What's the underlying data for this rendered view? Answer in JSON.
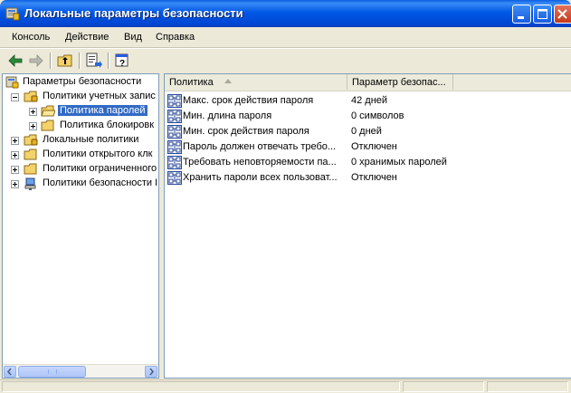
{
  "window": {
    "title": "Локальные параметры безопасности",
    "controls": [
      "minimize-icon",
      "maximize-icon",
      "close-icon"
    ]
  },
  "menu": {
    "items": [
      "Консоль",
      "Действие",
      "Вид",
      "Справка"
    ]
  },
  "toolbar": {
    "buttons": [
      "back-icon",
      "forward-icon",
      "up-level-icon",
      "export-list-icon",
      "help-icon"
    ]
  },
  "tree": {
    "root": "Параметры безопасности",
    "items": [
      {
        "label": "Политики учетных записей",
        "shown": "Политики учетных запис"
      },
      {
        "label": "Политика паролей",
        "selected": true
      },
      {
        "label": "Политика блокировки",
        "shown": "Политика блокировк"
      },
      {
        "label": "Локальные политики"
      },
      {
        "label": "Политики открытого клю",
        "shown": "Политики открытого клк"
      },
      {
        "label": "Политики ограниченного",
        "shown": "Политики ограниченного"
      },
      {
        "label": "Политики безопасности IP",
        "shown": "Политики безопасности I"
      }
    ]
  },
  "list": {
    "columns": [
      "Политика",
      "Параметр безопас..."
    ],
    "rows": [
      {
        "policy": "Макс. срок действия пароля",
        "value": "42 дней"
      },
      {
        "policy": "Мин. длина пароля",
        "value": "0 символов"
      },
      {
        "policy": "Мин. срок действия пароля",
        "value": "0 дней"
      },
      {
        "policy": "Пароль должен отвечать требо...",
        "value": "Отключен"
      },
      {
        "policy": "Требовать неповторяемости па...",
        "value": "0 хранимых паролей"
      },
      {
        "policy": "Хранить пароли всех пользоват...",
        "value": "Отключен"
      }
    ]
  },
  "colors": {
    "titlebar": "#0058e6",
    "selection": "#316ac5",
    "window_bg": "#ece9d8"
  }
}
